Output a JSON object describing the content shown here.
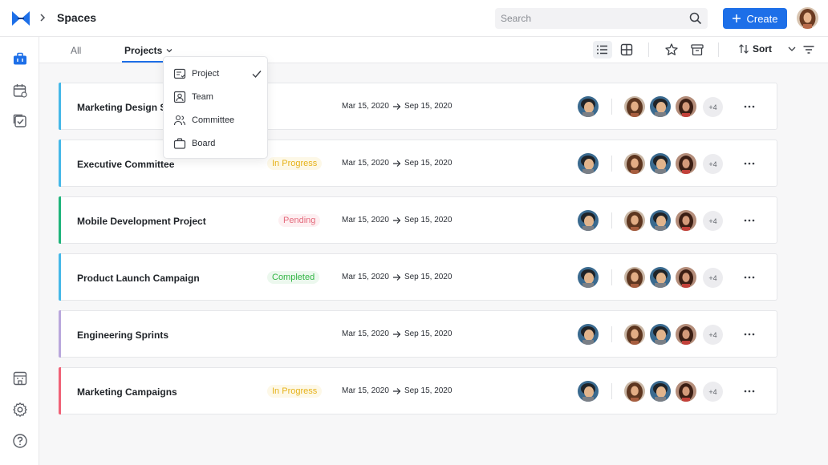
{
  "header": {
    "breadcrumb": "Spaces",
    "search_placeholder": "Search",
    "create_label": "Create"
  },
  "tabs": {
    "all": "All",
    "projects": "Projects"
  },
  "toolbar": {
    "sort_label": "Sort"
  },
  "dropdown": {
    "items": [
      {
        "label": "Project",
        "icon": "project-icon",
        "selected": true
      },
      {
        "label": "Team",
        "icon": "team-icon",
        "selected": false
      },
      {
        "label": "Committee",
        "icon": "committee-icon",
        "selected": false
      },
      {
        "label": "Board",
        "icon": "briefcase-icon",
        "selected": false
      }
    ]
  },
  "rows": [
    {
      "name": "Marketing Design Str",
      "status": "",
      "start": "Mar 15, 2020",
      "end": "Sep 15, 2020",
      "more": "+4",
      "accent": "#46b8e8"
    },
    {
      "name": "Executive Committee",
      "status": "In Progress",
      "start": "Mar 15, 2020",
      "end": "Sep 15, 2020",
      "more": "+4",
      "accent": "#46b8e8"
    },
    {
      "name": "Mobile Development Project",
      "status": "Pending",
      "start": "Mar 15, 2020",
      "end": "Sep 15, 2020",
      "more": "+4",
      "accent": "#1fb47b"
    },
    {
      "name": "Product Launch Campaign",
      "status": "Completed",
      "start": "Mar 15, 2020",
      "end": "Sep 15, 2020",
      "more": "+4",
      "accent": "#46b8e8"
    },
    {
      "name": "Engineering Sprints",
      "status": "",
      "start": "Mar 15, 2020",
      "end": "Sep 15, 2020",
      "more": "+4",
      "accent": "#b9a7dc"
    },
    {
      "name": "Marketing Campaigns",
      "status": "In Progress",
      "start": "Mar 15, 2020",
      "end": "Sep 15, 2020",
      "more": "+4",
      "accent": "#f06277"
    }
  ],
  "status_colors": {
    "In Progress": {
      "fg": "#e6b219",
      "bg": "#fdf8e7"
    },
    "Pending": {
      "fg": "#e46a7c",
      "bg": "#fdeff1"
    },
    "Completed": {
      "fg": "#33b545",
      "bg": "#ecf8ee"
    }
  },
  "colors": {
    "brand": "#1d6fe8"
  }
}
